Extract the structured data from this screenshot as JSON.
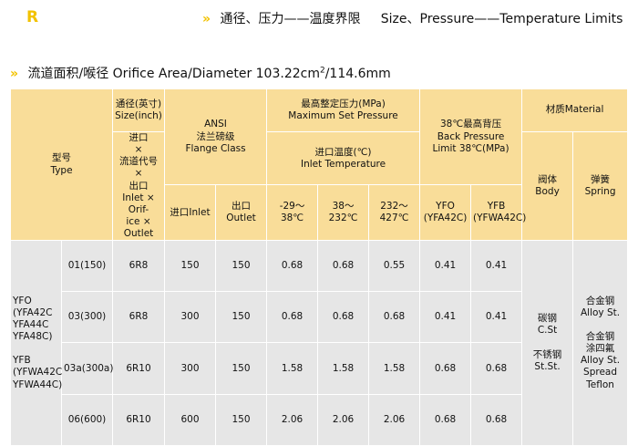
{
  "header": {
    "letter": "R",
    "title_cn": "通径、压力——温度界限",
    "title_en": "Size、Pressure——Temperature Limits"
  },
  "subtitle": {
    "prefix": "流道面积/喉径 Orifice Area/Diameter 103.22cm",
    "sup": "2",
    "suffix": "/114.6mm"
  },
  "table": {
    "type_header": [
      "型号",
      "Type"
    ],
    "size_header": [
      "通径(英寸)",
      "Size(inch)"
    ],
    "code_header": [
      "进口",
      "×",
      "流道代号",
      "×",
      "出口",
      "Inlet × Orif-",
      "ice × Outlet"
    ],
    "ansi_header": [
      "ANSI",
      "法兰磅级",
      "Flange Class"
    ],
    "inlet_label": "进口Inlet",
    "outlet_label": "出口Outlet",
    "max_set_header": [
      "最高整定压力(MPa)",
      "Maximum Set Pressure"
    ],
    "inlet_temp_header": [
      "进口温度(℃)",
      "Inlet Temperature"
    ],
    "temp_cols": [
      "-29～38℃",
      "38～232℃",
      "232～427℃"
    ],
    "back_header": [
      "38℃最高背压",
      "Back Pressure",
      "Limit 38℃(MPa)"
    ],
    "back_cols": [
      [
        "YFO",
        "(YFA42C)"
      ],
      [
        "YFB",
        "(YFWA42C)"
      ]
    ],
    "material_header": "材质Material",
    "body_header": [
      "阀体",
      "Body"
    ],
    "spring_header": [
      "弹簧",
      "Spring"
    ],
    "type_lines": [
      "YFO",
      "(YFA42C",
      "YFA44C",
      "YFA48C)",
      "",
      "YFB",
      "(YFWA42C",
      "YFWA44C)"
    ],
    "rows": [
      {
        "size": "01(150)",
        "code": "6R8",
        "inlet": "150",
        "outlet": "150",
        "t1": "0.68",
        "t2": "0.68",
        "t3": "0.55",
        "b1": "0.41",
        "b2": "0.41"
      },
      {
        "size": "03(300)",
        "code": "6R8",
        "inlet": "300",
        "outlet": "150",
        "t1": "0.68",
        "t2": "0.68",
        "t3": "0.68",
        "b1": "0.41",
        "b2": "0.41"
      },
      {
        "size": "03a(300a)",
        "code": "6R10",
        "inlet": "300",
        "outlet": "150",
        "t1": "1.58",
        "t2": "1.58",
        "t3": "1.58",
        "b1": "0.68",
        "b2": "0.68"
      },
      {
        "size": "06(600)",
        "code": "6R10",
        "inlet": "600",
        "outlet": "150",
        "t1": "2.06",
        "t2": "2.06",
        "t3": "2.06",
        "b1": "0.68",
        "b2": "0.68"
      }
    ],
    "body_material": [
      "碳钢",
      "C.St",
      "",
      "不锈钢",
      "St.St."
    ],
    "spring_material": [
      "合金钢",
      "Alloy St.",
      "",
      "合金钢",
      "涂四氟",
      "Alloy St.",
      "Spread",
      "Teflon"
    ]
  }
}
